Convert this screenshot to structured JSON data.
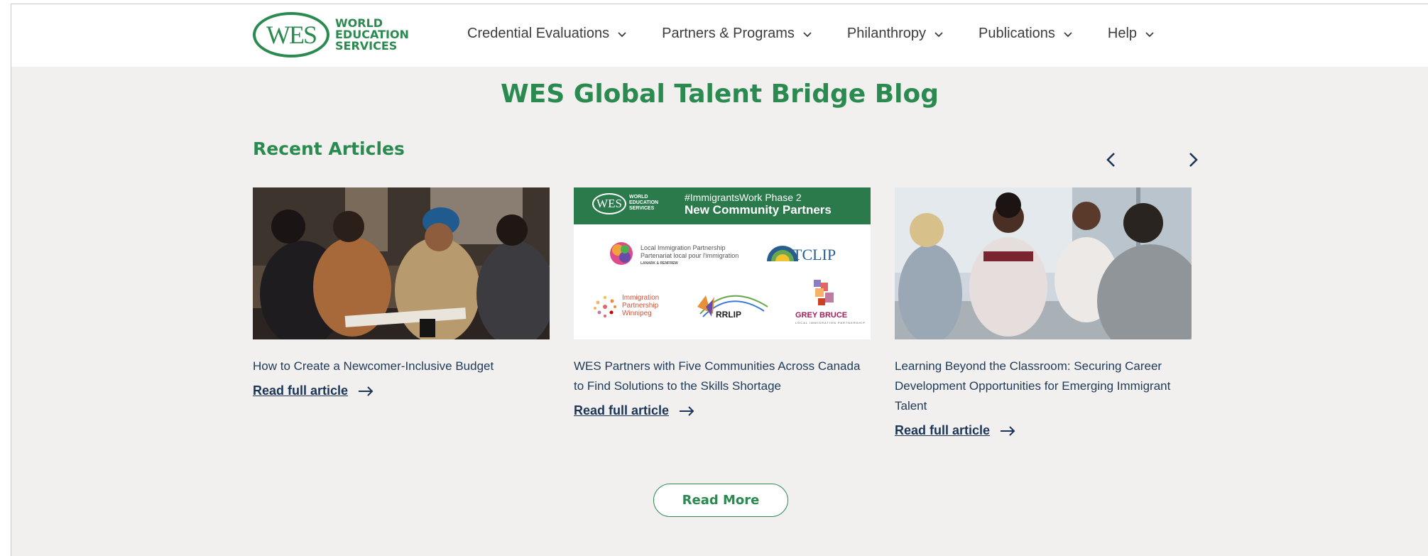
{
  "header": {
    "logo_mark": "WES",
    "logo_words": [
      "WORLD",
      "EDUCATION",
      "SERVICES"
    ],
    "nav": [
      {
        "label": "Credential Evaluations"
      },
      {
        "label": "Partners & Programs"
      },
      {
        "label": "Philanthropy"
      },
      {
        "label": "Publications"
      },
      {
        "label": "Help"
      }
    ]
  },
  "main": {
    "title": "WES Global Talent Bridge Blog",
    "section_title": "Recent Articles",
    "carousel": {
      "prev_icon": "chevron-left-icon",
      "next_icon": "chevron-right-icon"
    },
    "articles": [
      {
        "title": "How to Create a Newcomer-Inclusive Budget",
        "link": "Read full article",
        "image": "photo of four people discussing papers at a table"
      },
      {
        "title": "WES Partners with Five Communities Across Canada to Find Solutions to the Skills Shortage",
        "link": "Read full article",
        "image_banner": {
          "logo": "WES",
          "logo_words": [
            "WORLD",
            "EDUCATION",
            "SERVICES"
          ],
          "subtitle": "#ImmigrantsWork Phase 2",
          "title": "New Community Partners"
        },
        "partners": [
          {
            "name": "Local Immigration Partnership",
            "line2": "Partenariat local pour l'immigration",
            "line3": "LANARK & RENFREW"
          },
          {
            "name": "TCLIP"
          },
          {
            "name": "Immigration Partnership Winnipeg"
          },
          {
            "name": "RRLIP"
          },
          {
            "name": "GREY BRUCE",
            "line2": "LOCAL IMMIGRATION PARTNERSHIP"
          }
        ]
      },
      {
        "title": "Learning Beyond the Classroom: Securing Career Development Opportunities for Emerging Immigrant Talent",
        "link": "Read full article",
        "image": "photo of a group of people sitting in a circle talking"
      }
    ],
    "read_more": "Read More"
  },
  "colors": {
    "brand_green": "#2a8a4f",
    "link_navy": "#1b3556",
    "page_bg": "#f1f0ef"
  }
}
